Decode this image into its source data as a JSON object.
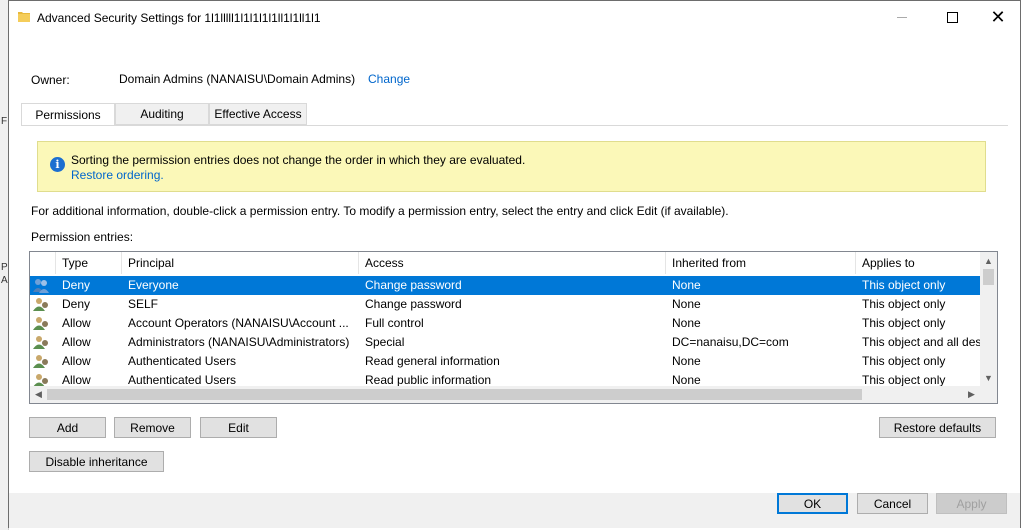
{
  "window": {
    "title": "Advanced Security Settings for 1l1lllll1l1l1l1l1ll1l1ll1l1"
  },
  "owner": {
    "label": "Owner:",
    "value": "Domain Admins (NANAISU\\Domain Admins)",
    "change_label": "Change"
  },
  "tabs": [
    {
      "label": "Permissions",
      "active": true
    },
    {
      "label": "Auditing",
      "active": false
    },
    {
      "label": "Effective Access",
      "active": false
    }
  ],
  "info": {
    "message": "Sorting the permission entries does not change the order in which they are evaluated.",
    "link": "Restore ordering."
  },
  "hint": "For additional information, double-click a permission entry. To modify a permission entry, select the entry and click Edit (if available).",
  "permission_entries_label": "Permission entries:",
  "columns": [
    "Type",
    "Principal",
    "Access",
    "Inherited from",
    "Applies to"
  ],
  "rows": [
    {
      "type": "Deny",
      "principal": "Everyone",
      "access": "Change password",
      "inherited": "None",
      "applies": "This object only",
      "selected": true
    },
    {
      "type": "Deny",
      "principal": "SELF",
      "access": "Change password",
      "inherited": "None",
      "applies": "This object only"
    },
    {
      "type": "Allow",
      "principal": "Account Operators (NANAISU\\Account ...",
      "access": "Full control",
      "inherited": "None",
      "applies": "This object only"
    },
    {
      "type": "Allow",
      "principal": "Administrators (NANAISU\\Administrators)",
      "access": "Special",
      "inherited": "DC=nanaisu,DC=com",
      "applies": "This object and all des"
    },
    {
      "type": "Allow",
      "principal": "Authenticated Users",
      "access": "Read general information",
      "inherited": "None",
      "applies": "This object only"
    },
    {
      "type": "Allow",
      "principal": "Authenticated Users",
      "access": "Read public information",
      "inherited": "None",
      "applies": "This object only"
    }
  ],
  "buttons": {
    "add": "Add",
    "remove": "Remove",
    "edit": "Edit",
    "restore_defaults": "Restore defaults",
    "disable_inheritance": "Disable inheritance",
    "ok": "OK",
    "cancel": "Cancel",
    "apply": "Apply"
  },
  "left_strip": [
    "F",
    "P",
    "A"
  ],
  "colors": {
    "selection": "#0078d7",
    "link": "#0066cc",
    "info_bg": "#fbf8b8"
  }
}
